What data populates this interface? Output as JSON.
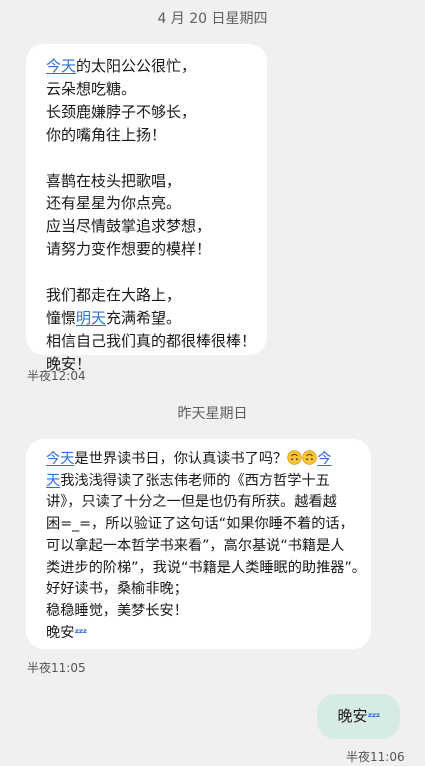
{
  "messages": [
    {
      "date_separator": "4 月 20 日星期四",
      "lines": [
        {
          "link": "今天",
          "text": "的太阳公公很忙，"
        },
        {
          "text": "云朵想吃糖。"
        },
        {
          "text": "长颈鹿嫌脖子不够长，"
        },
        {
          "text": "你的嘴角往上扬！"
        },
        {
          "text": ""
        },
        {
          "text": "喜鹊在枝头把歌唱，"
        },
        {
          "text": "还有星星为你点亮。"
        },
        {
          "text": "应当尽情鼓掌追求梦想，"
        },
        {
          "text": "请努力变作想要的模样！"
        },
        {
          "text": ""
        },
        {
          "text": "我们都走在大路上，"
        },
        {
          "pre": "憧憬",
          "link": "明天",
          "text": "充满希望。"
        },
        {
          "text": "相信自己我们真的都很棒很棒！"
        },
        {
          "text": "晚安！"
        }
      ],
      "time": "半夜12:04"
    },
    {
      "date_separator": "昨天星期日",
      "lines": [
        {
          "link": "今天",
          "text": "是世界读书日，你认真读书了吗？",
          "emoji": "upside-down-face-emoji-x2",
          "link2": "今"
        },
        {
          "link": "天",
          "text": "我浅浅得读了张志伟老师的《西方哲学十五"
        },
        {
          "text": "讲》，只读了十分之一但是也仍有所获。越看越"
        },
        {
          "text": "困=_=，所以验证了这句话“如果你睡不着的话，"
        },
        {
          "text": "可以拿起一本哲学书来看”，高尔基说“书籍是人"
        },
        {
          "text": "类进步的阶梯”，我说“书籍是人类睡眠的助推器”。"
        },
        {
          "text": "好好读书，桑榆非晚；"
        },
        {
          "text": "稳稳睡觉，美梦长安！"
        },
        {
          "text": "晚安",
          "emoji": "zzz-emoji"
        }
      ],
      "time": "半夜11:05"
    },
    {
      "outgoing": true,
      "text": "晚安",
      "emoji": "zzz-emoji",
      "time": "半夜11:06"
    }
  ],
  "colors": {
    "background": "#f0f0f0",
    "incoming_bubble": "#ffffff",
    "outgoing_bubble": "#d6ebe1",
    "link": "#2f6fd6",
    "zzz": "#3b6fd1"
  },
  "icons": {
    "upside_down_face": "upside-down-face-emoji",
    "zzz": "zzz-emoji"
  }
}
